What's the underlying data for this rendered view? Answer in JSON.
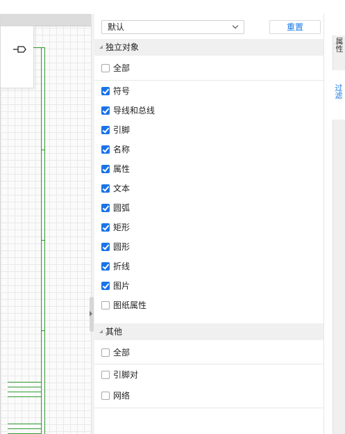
{
  "filter_panel": {
    "preset": {
      "value": "默认"
    },
    "reset_label": "重置",
    "groups": [
      {
        "title": "独立对象",
        "items": [
          {
            "label": "全部",
            "checked": false
          },
          {
            "label": "符号",
            "checked": true
          },
          {
            "label": "导线和总线",
            "checked": true
          },
          {
            "label": "引脚",
            "checked": true
          },
          {
            "label": "名称",
            "checked": true
          },
          {
            "label": "属性",
            "checked": true
          },
          {
            "label": "文本",
            "checked": true
          },
          {
            "label": "圆弧",
            "checked": true
          },
          {
            "label": "矩形",
            "checked": true
          },
          {
            "label": "圆形",
            "checked": true
          },
          {
            "label": "折线",
            "checked": true
          },
          {
            "label": "图片",
            "checked": true
          },
          {
            "label": "图纸属性",
            "checked": false
          }
        ]
      },
      {
        "title": "其他",
        "items": [
          {
            "label": "全部",
            "checked": false
          },
          {
            "label": "引脚对",
            "checked": false
          },
          {
            "label": "网络",
            "checked": false
          }
        ]
      }
    ]
  },
  "side_tabs": [
    {
      "label": "属性",
      "active": false
    },
    {
      "label": "过滤",
      "active": true
    }
  ],
  "colors": {
    "accent": "#1677e5",
    "wire": "#2e9a2e",
    "checkbox": "#1a73e8"
  }
}
